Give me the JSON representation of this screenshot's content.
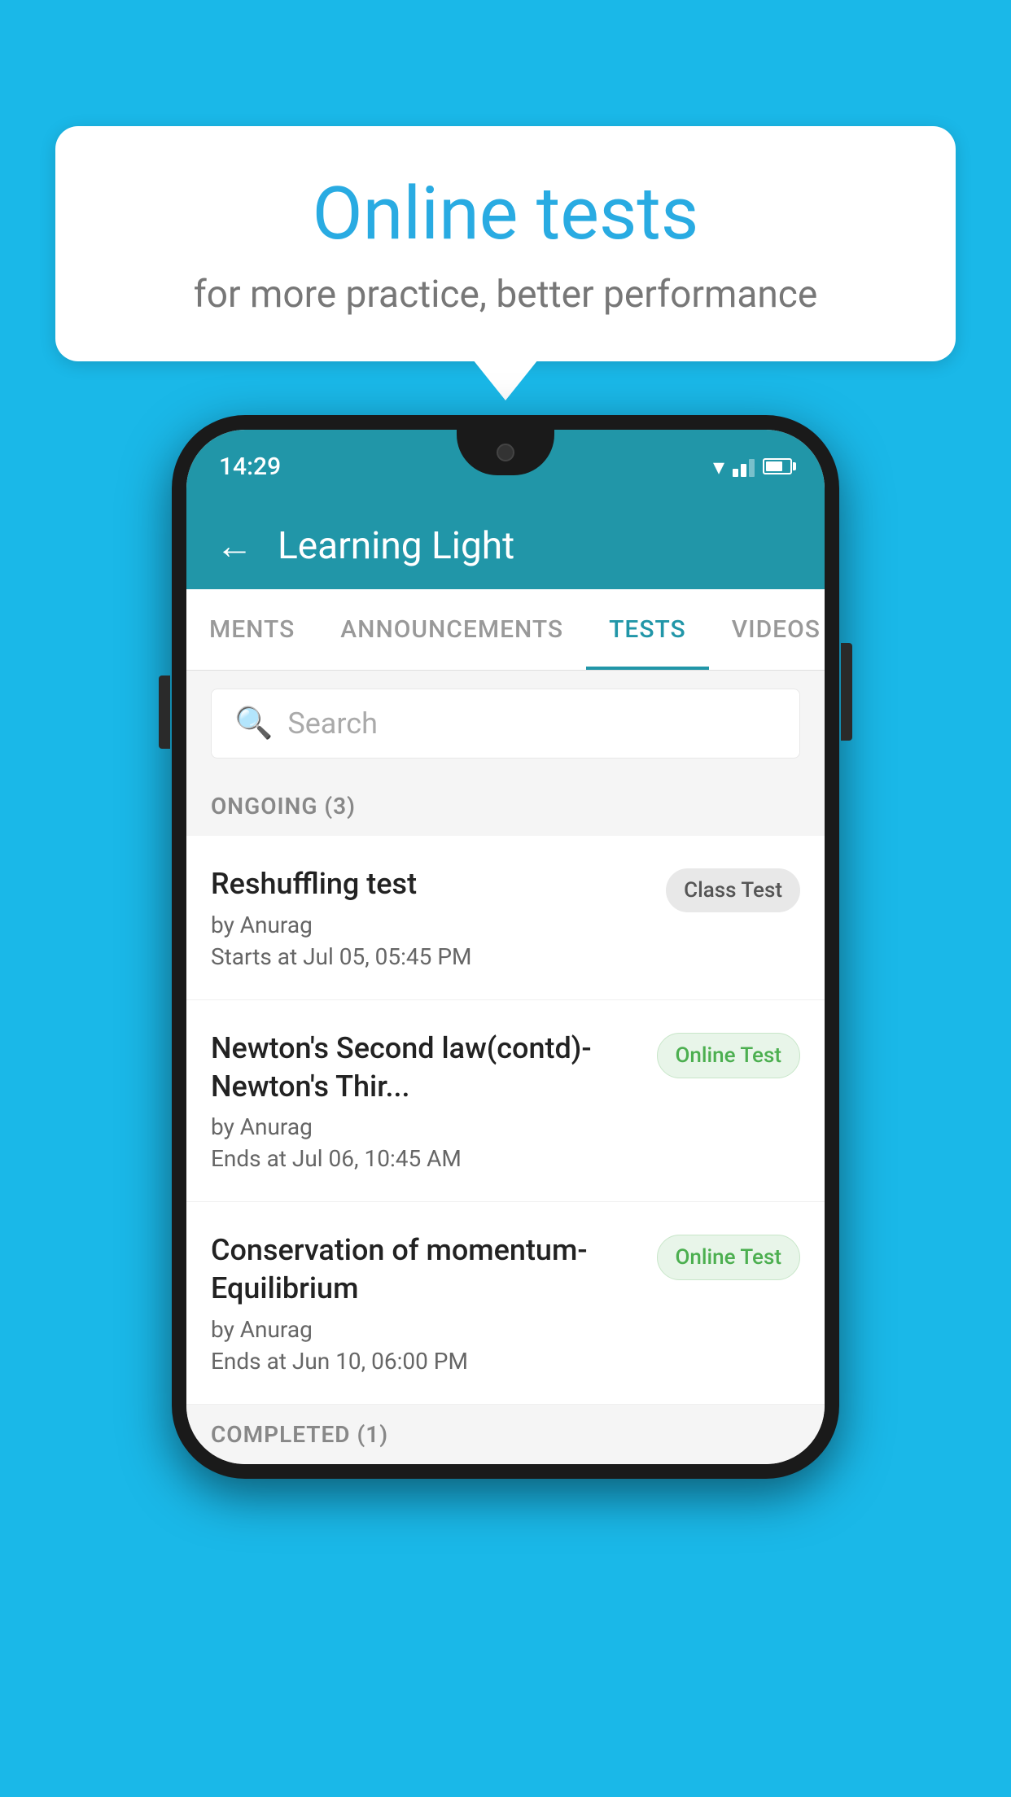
{
  "background_color": "#1ab8e8",
  "bubble": {
    "title": "Online tests",
    "subtitle": "for more practice, better performance"
  },
  "phone": {
    "status_bar": {
      "time": "14:29"
    },
    "header": {
      "title": "Learning Light",
      "back_label": "←"
    },
    "tabs": [
      {
        "id": "ments",
        "label": "MENTS",
        "active": false
      },
      {
        "id": "announcements",
        "label": "ANNOUNCEMENTS",
        "active": false
      },
      {
        "id": "tests",
        "label": "TESTS",
        "active": true
      },
      {
        "id": "videos",
        "label": "VIDEOS",
        "active": false
      }
    ],
    "search": {
      "placeholder": "Search"
    },
    "ongoing_section": {
      "label": "ONGOING (3)"
    },
    "test_items": [
      {
        "id": "test-1",
        "name": "Reshuffling test",
        "by": "by Anurag",
        "time": "Starts at  Jul 05, 05:45 PM",
        "badge": "Class Test",
        "badge_type": "class"
      },
      {
        "id": "test-2",
        "name": "Newton's Second law(contd)-Newton's Thir...",
        "by": "by Anurag",
        "time": "Ends at  Jul 06, 10:45 AM",
        "badge": "Online Test",
        "badge_type": "online"
      },
      {
        "id": "test-3",
        "name": "Conservation of momentum-Equilibrium",
        "by": "by Anurag",
        "time": "Ends at  Jun 10, 06:00 PM",
        "badge": "Online Test",
        "badge_type": "online"
      }
    ],
    "completed_section": {
      "label": "COMPLETED (1)"
    }
  }
}
